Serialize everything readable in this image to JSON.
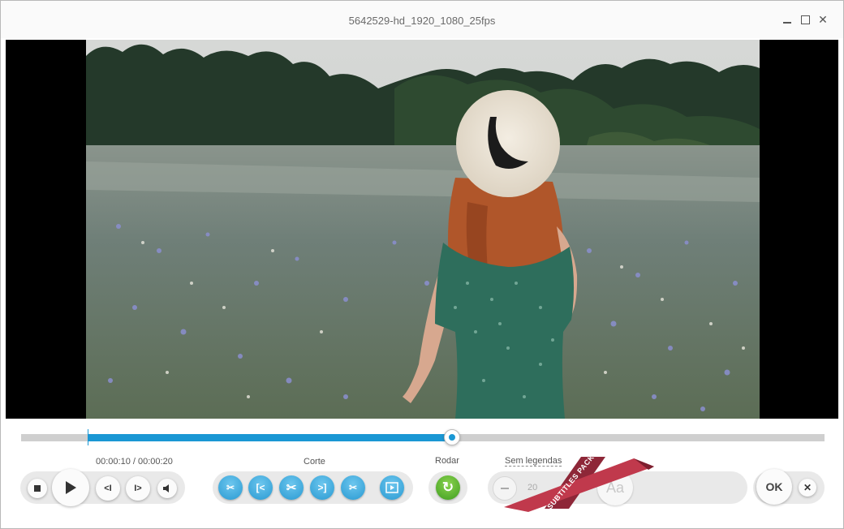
{
  "window": {
    "title": "5642529-hd_1920_1080_25fps",
    "controls": {
      "minimize": "–",
      "maximize": "☐",
      "close": "✕"
    }
  },
  "player": {
    "time": "00:00:10 / 00:00:20",
    "trim_start_fraction": 0.084,
    "position_fraction": 0.535
  },
  "cut": {
    "label": "Corte",
    "buttons": [
      "cut-start-button",
      "go-to-start-button",
      "cut-button",
      "go-to-end-button",
      "cut-end-button"
    ]
  },
  "rotate": {
    "label": "Rodar"
  },
  "subtitles": {
    "label": "Sem legendas",
    "size_value": "20",
    "font_button": "Aa",
    "ribbon": "SUBTITLES PACK"
  },
  "actions": {
    "ok": "OK",
    "close": "✕"
  },
  "colors": {
    "accent": "#1a97d4",
    "rotate": "#4caf2a",
    "ribbon": "#c0394c"
  }
}
